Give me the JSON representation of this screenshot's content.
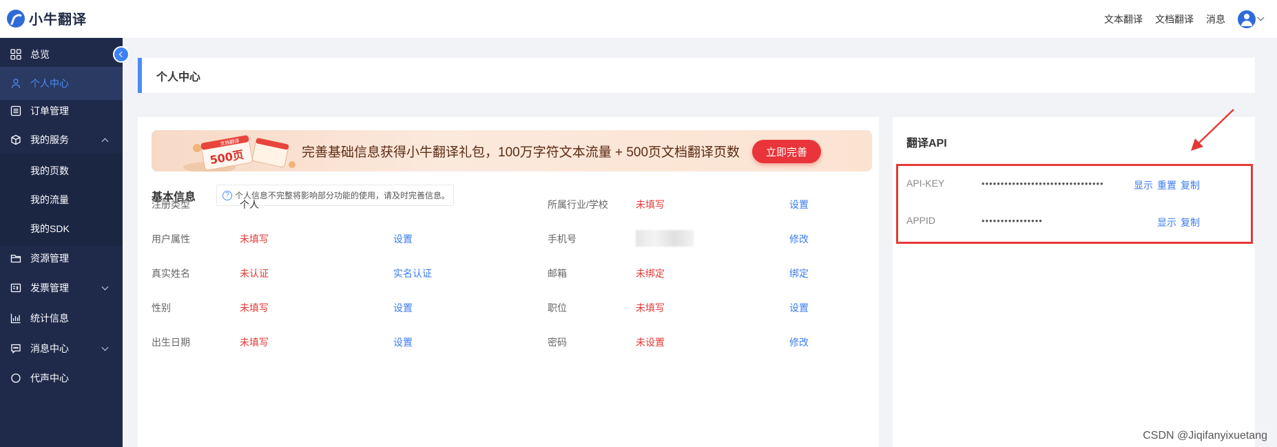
{
  "header": {
    "logo_text": "小牛翻译",
    "nav": [
      "文本翻译",
      "文档翻译",
      "消息"
    ]
  },
  "sidebar": {
    "items": [
      {
        "label": "总览",
        "icon": "grid-icon"
      },
      {
        "label": "个人中心",
        "icon": "person-icon"
      },
      {
        "label": "订单管理",
        "icon": "list-icon"
      },
      {
        "label": "我的服务",
        "icon": "box-icon"
      },
      {
        "label": "资源管理",
        "icon": "folder-icon"
      },
      {
        "label": "发票管理",
        "icon": "invoice-icon"
      },
      {
        "label": "统计信息",
        "icon": "chart-icon"
      },
      {
        "label": "消息中心",
        "icon": "message-icon"
      },
      {
        "label": "代声中心",
        "icon": "misc-icon"
      }
    ],
    "sub_items": [
      "我的页数",
      "我的流量",
      "我的SDK"
    ]
  },
  "page_title": "个人中心",
  "banner": {
    "text": "完善基础信息获得小牛翻译礼包，100万字符文本流量 + 500页文档翻译页数",
    "button": "立即完善",
    "deco_tag": "文档翻译",
    "deco_number": "500页"
  },
  "basic_info": {
    "title": "基本信息",
    "hint": "个人信息不完整将影响部分功能的使用，请及时完善信息。",
    "left_rows": [
      {
        "label": "注册类型",
        "value": "个人",
        "value_red": false,
        "action": ""
      },
      {
        "label": "用户属性",
        "value": "未填写",
        "value_red": true,
        "action": "设置"
      },
      {
        "label": "真实姓名",
        "value": "未认证",
        "value_red": true,
        "action": "实名认证"
      },
      {
        "label": "性别",
        "value": "未填写",
        "value_red": true,
        "action": "设置"
      },
      {
        "label": "出生日期",
        "value": "未填写",
        "value_red": true,
        "action": "设置"
      }
    ],
    "right_rows": [
      {
        "label": "所属行业/学校",
        "value": "未填写",
        "value_red": true,
        "action": "设置"
      },
      {
        "label": "手机号",
        "value": "",
        "value_red": false,
        "action": "修改"
      },
      {
        "label": "邮箱",
        "value": "未绑定",
        "value_red": true,
        "action": "绑定"
      },
      {
        "label": "职位",
        "value": "未填写",
        "value_red": true,
        "action": "设置"
      },
      {
        "label": "密码",
        "value": "未设置",
        "value_red": true,
        "action": "修改"
      }
    ]
  },
  "api": {
    "title": "翻译API",
    "rows": [
      {
        "label": "API-KEY",
        "value": "••••••••••••••••••••••••••••••••",
        "actions": [
          "显示",
          "重置",
          "复制"
        ]
      },
      {
        "label": "APPID",
        "value": "••••••••••••••••",
        "actions": [
          "显示",
          "复制"
        ]
      }
    ]
  },
  "watermark": "CSDN @Jiqifanyixuetang",
  "colors": {
    "accent": "#3b7cf0",
    "sidebar_bg": "#1f2a4b",
    "danger": "#e53935"
  }
}
